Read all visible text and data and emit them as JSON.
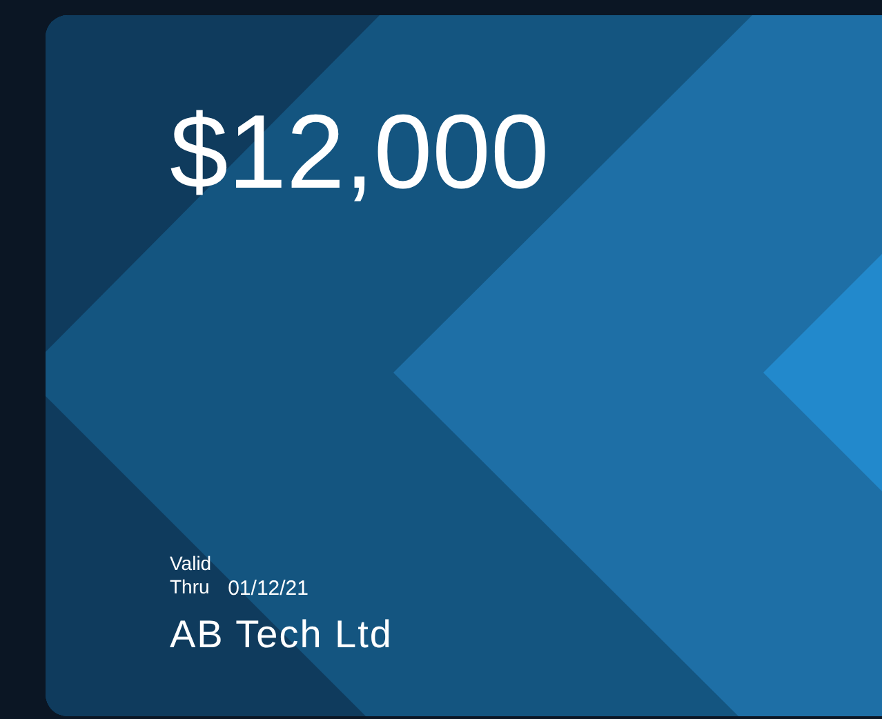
{
  "card": {
    "amount": "$12,000",
    "valid_label": "Valid\nThru",
    "valid_date": "01/12/21",
    "holder": "AB Tech Ltd"
  }
}
